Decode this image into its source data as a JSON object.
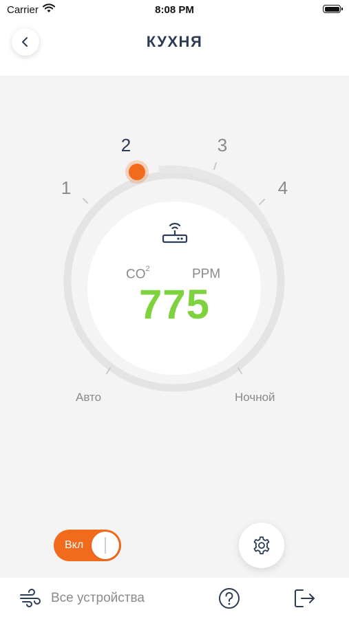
{
  "status_bar": {
    "carrier": "Carrier",
    "time": "8:08 PM"
  },
  "header": {
    "title": "КУХНЯ",
    "back_icon": "chevron-left-icon"
  },
  "dial": {
    "speed_labels": [
      "1",
      "2",
      "3",
      "4"
    ],
    "active_speed": "2",
    "mode_labels": {
      "auto": "Авто",
      "night": "Ночной"
    },
    "colors": {
      "track": "#e4e4e4",
      "indicator": "#f26b1d",
      "active_label": "#2b3a55"
    }
  },
  "sensor": {
    "device_icon": "router-icon",
    "co2_label": "CO",
    "co2_sup": "2",
    "unit": "PPM",
    "value": "775",
    "value_color": "#7ed23e"
  },
  "controls": {
    "power_label": "Вкл",
    "power_on": true,
    "power_color": "#f26b1d",
    "settings_icon": "gear-icon"
  },
  "bottom_bar": {
    "all_devices_label": "Все устройства",
    "all_devices_icon": "fan-wind-icon",
    "help_icon": "question-icon",
    "exit_icon": "logout-icon"
  }
}
